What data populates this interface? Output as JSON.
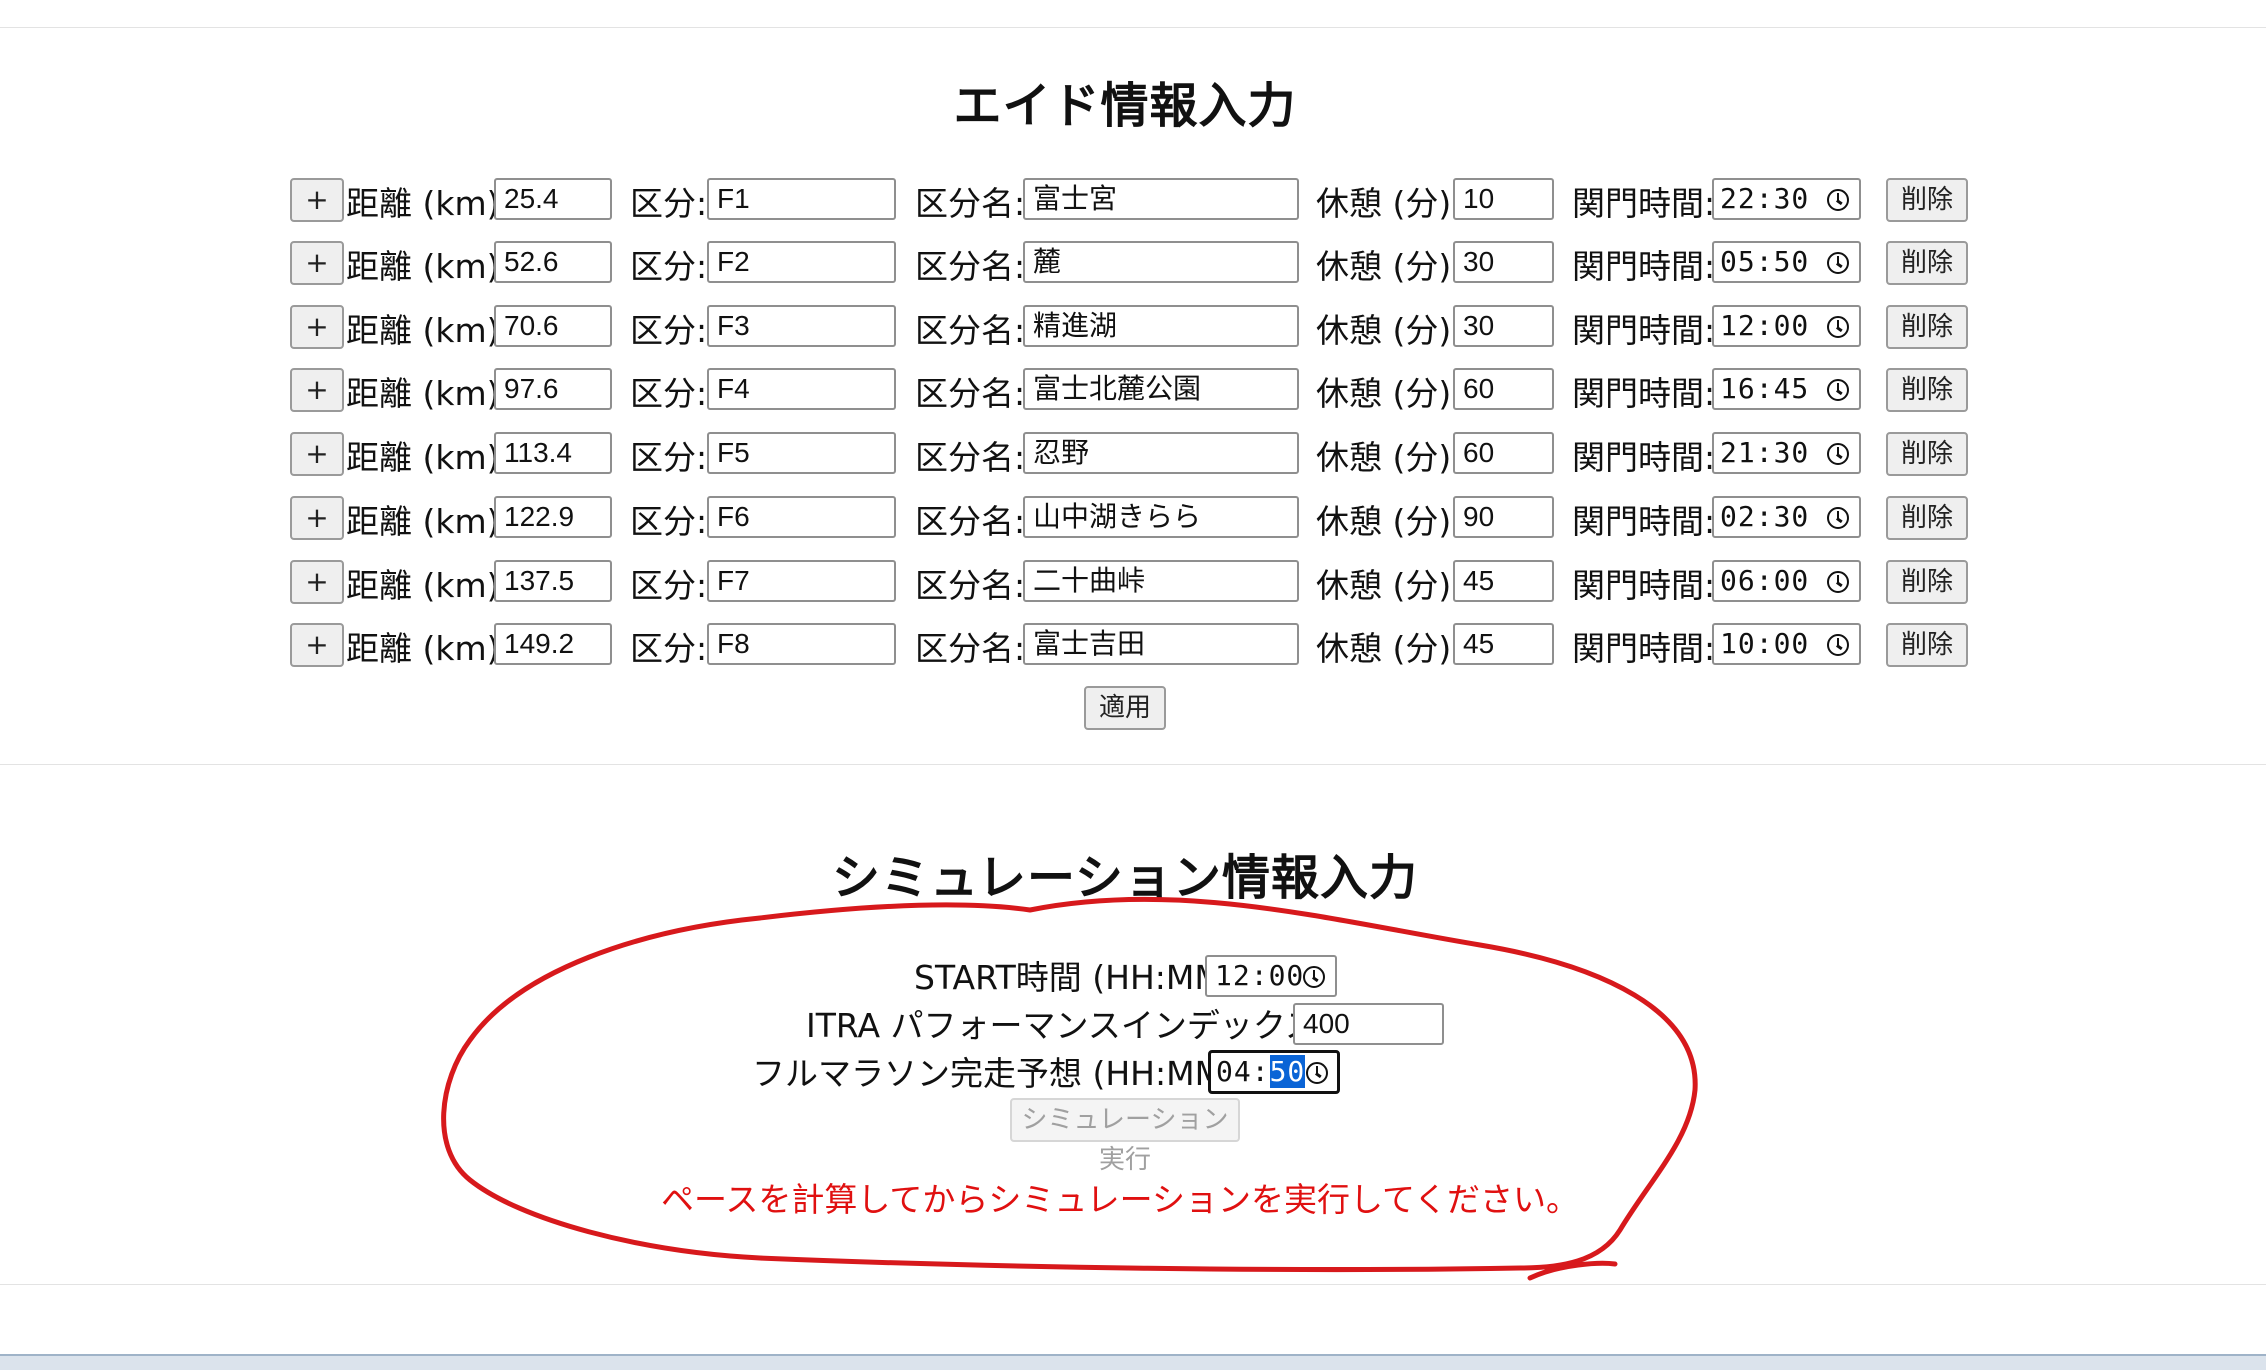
{
  "aid_section": {
    "title": "エイド情報入力",
    "labels": {
      "plus": "+",
      "distance": "距離 (km):",
      "segment": "区分:",
      "segment_name": "区分名:",
      "rest": "休憩 (分):",
      "cutoff": "関門時間:",
      "delete": "削除"
    },
    "rows": [
      {
        "distance": "25.4",
        "segment": "F1",
        "name": "富士宮",
        "rest": "10",
        "cutoff": "22:30"
      },
      {
        "distance": "52.6",
        "segment": "F2",
        "name": "麓",
        "rest": "30",
        "cutoff": "05:50"
      },
      {
        "distance": "70.6",
        "segment": "F3",
        "name": "精進湖",
        "rest": "30",
        "cutoff": "12:00"
      },
      {
        "distance": "97.6",
        "segment": "F4",
        "name": "富士北麓公園",
        "rest": "60",
        "cutoff": "16:45"
      },
      {
        "distance": "113.4",
        "segment": "F5",
        "name": "忍野",
        "rest": "60",
        "cutoff": "21:30"
      },
      {
        "distance": "122.9",
        "segment": "F6",
        "name": "山中湖きらら",
        "rest": "90",
        "cutoff": "02:30"
      },
      {
        "distance": "137.5",
        "segment": "F7",
        "name": "二十曲峠",
        "rest": "45",
        "cutoff": "06:00"
      },
      {
        "distance": "149.2",
        "segment": "F8",
        "name": "富士吉田",
        "rest": "45",
        "cutoff": "10:00"
      }
    ],
    "apply_label": "適用"
  },
  "sim_section": {
    "title": "シミュレーション情報入力",
    "start_label": "START時間 (HH:MM):",
    "start_value": "12:00",
    "itra_label": "ITRA パフォーマンスインデックス:",
    "itra_value": "400",
    "marathon_label": "フルマラソン完走予想 (HH:MM):",
    "marathon_hours": "04",
    "marathon_sep": ":",
    "marathon_minutes": "50",
    "run_label": "シミュレーション実行",
    "message": "ペースを計算してからシミュレーションを実行してください。"
  },
  "colors": {
    "annotation": "#d7191c",
    "message": "#e01010",
    "selection": "#0a64d6"
  },
  "icons": [
    "clock-icon"
  ]
}
